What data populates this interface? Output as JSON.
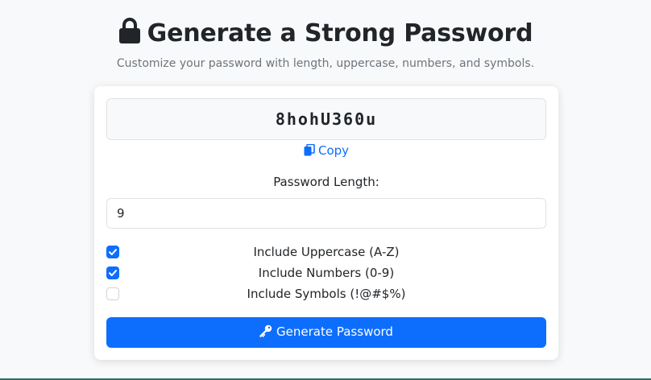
{
  "header": {
    "title": "Generate a Strong Password",
    "subtitle": "Customize your password with length, uppercase, numbers, and symbols."
  },
  "generator": {
    "password": "8hohU360u",
    "copy_label": "Copy",
    "length_label": "Password Length:",
    "length_value": "9",
    "options": [
      {
        "label": "Include Uppercase (A-Z)",
        "checked": true
      },
      {
        "label": "Include Numbers (0-9)",
        "checked": true
      },
      {
        "label": "Include Symbols (!@#$%)",
        "checked": false
      }
    ],
    "generate_label": "Generate Password"
  },
  "icons": {
    "title": "lock-icon",
    "copy": "copy-icon",
    "generate": "key-icon"
  },
  "colors": {
    "accent": "#0d6efd",
    "background": "#f8f9fa",
    "text": "#212529",
    "muted": "#6c757d"
  }
}
